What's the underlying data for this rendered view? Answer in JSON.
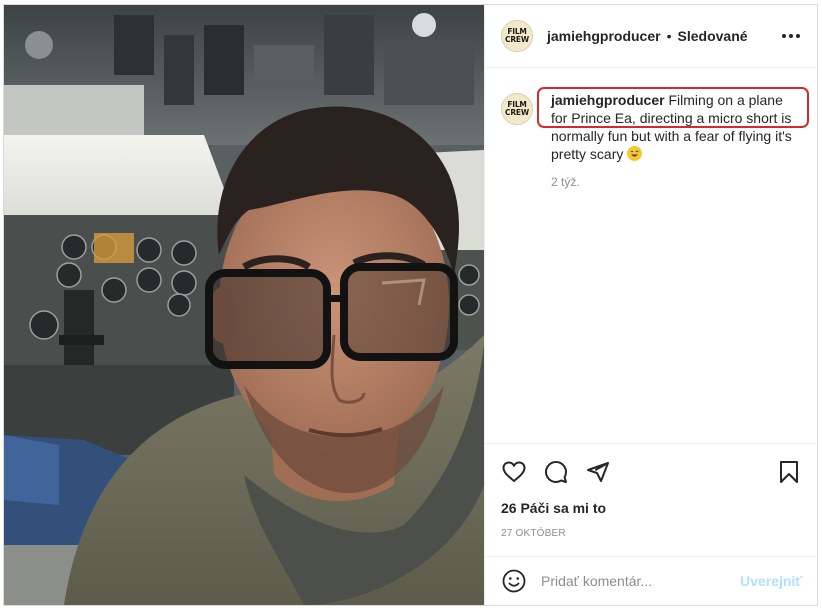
{
  "post": {
    "photo_alt": "",
    "author": {
      "username": "jamiehgproducer",
      "avatar_text_line1": "FILM",
      "avatar_text_line2": "CREW"
    },
    "header": {
      "separator": "•",
      "follow_state": "Sledované"
    },
    "caption": {
      "username": "jamiehgproducer",
      "text": "Filming on a plane for Prince Ea, directing a micro short is normally fun but with a fear of flying it's pretty scary",
      "time_ago": "2 týž."
    },
    "actions": {
      "like_icon": "heart-icon",
      "comment_icon": "comment-icon",
      "share_icon": "send-icon",
      "save_icon": "bookmark-icon"
    },
    "likes": "26 Páči sa mi to",
    "date": "27 OKTÓBER",
    "comment_box": {
      "placeholder": "Pridať komentár...",
      "post_label": "Uverejniť"
    },
    "colors": {
      "highlight": "#d42a2a",
      "post_button_disabled": "#b2dffc",
      "secondary_text": "#8e8e8e"
    }
  }
}
